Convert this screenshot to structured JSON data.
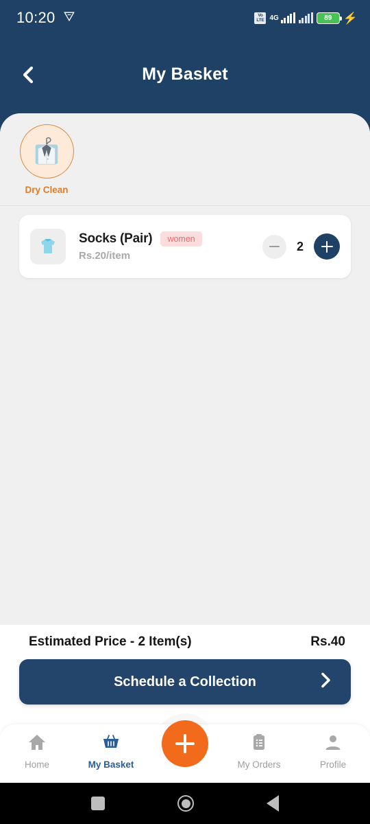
{
  "statusbar": {
    "clock": "10:20",
    "vpn_icon": "vpn-shield-icon",
    "volte_line1": "Vo",
    "volte_line2": "LTE",
    "network_type": "4G",
    "battery_percent": "89",
    "charging_icon": "charging-bolt-icon"
  },
  "appbar": {
    "title": "My Basket",
    "back_icon": "back-chevron-icon"
  },
  "categories": [
    {
      "label": "Dry Clean",
      "icon": "dry-clean-suit-icon",
      "selected": true
    }
  ],
  "items": [
    {
      "name": "Socks (Pair)",
      "badge": "women",
      "price": "Rs.20/item",
      "quantity": "2",
      "thumb_icon": "tshirt-icon",
      "decrement_icon": "minus-icon",
      "increment_icon": "plus-icon"
    }
  ],
  "footer": {
    "estimate_label": "Estimated Price - 2 Item(s)",
    "estimate_value": "Rs.40",
    "cta_label": "Schedule a Collection",
    "cta_icon": "chevron-right-icon"
  },
  "bottom_nav": {
    "items": [
      {
        "label": "Home",
        "icon": "home-icon",
        "active": false
      },
      {
        "label": "My Basket",
        "icon": "basket-icon",
        "active": true
      },
      {
        "label": "My Orders",
        "icon": "clipboard-list-icon",
        "active": false
      },
      {
        "label": "Profile",
        "icon": "person-icon",
        "active": false
      }
    ],
    "fab_icon": "plus-icon"
  },
  "system_nav": {
    "recents_icon": "square-recents-icon",
    "home_icon": "circle-home-icon",
    "back_icon": "triangle-back-icon"
  },
  "colors": {
    "navy": "#1f4165",
    "orange": "#f26a1b",
    "category_orange": "#e07d28",
    "badge_pink": "#fbdddd",
    "sheet_gray": "#f0f0f0"
  }
}
